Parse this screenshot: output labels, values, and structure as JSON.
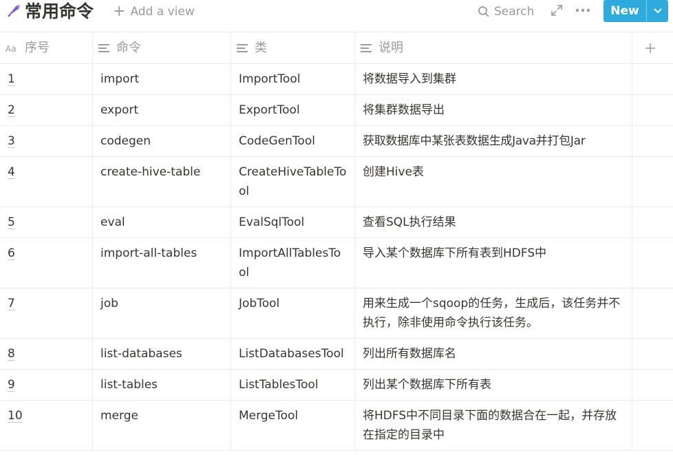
{
  "header": {
    "title": "常用命令",
    "add_view_label": "Add a view",
    "search_label": "Search",
    "new_button_label": "New",
    "accent_color": "#2eaadc"
  },
  "table": {
    "columns": [
      {
        "label": "序号",
        "icon": "title-property-icon"
      },
      {
        "label": "命令",
        "icon": "text-property-icon"
      },
      {
        "label": "类",
        "icon": "text-property-icon"
      },
      {
        "label": "说明",
        "icon": "text-property-icon"
      }
    ],
    "add_column_icon": "plus-icon",
    "rows": [
      {
        "num": "1",
        "cmd": "import",
        "cls": "ImportTool",
        "desc": "将数据导入到集群"
      },
      {
        "num": "2",
        "cmd": "export",
        "cls": "ExportTool",
        "desc": "将集群数据导出"
      },
      {
        "num": "3",
        "cmd": "codegen",
        "cls": "CodeGenTool",
        "desc": "获取数据库中某张表数据生成Java并打包Jar"
      },
      {
        "num": "4",
        "cmd": "create-hive-table",
        "cls": "CreateHiveTableTool",
        "desc": "创建Hive表"
      },
      {
        "num": "5",
        "cmd": "eval",
        "cls": "EvalSqlTool",
        "desc": "查看SQL执行结果"
      },
      {
        "num": "6",
        "cmd": "import-all-tables",
        "cls": "ImportAllTablesTool",
        "desc": "导入某个数据库下所有表到HDFS中"
      },
      {
        "num": "7",
        "cmd": "job",
        "cls": "JobTool",
        "desc": "用来生成一个sqoop的任务，生成后，该任务并不执行，除非使用命令执行该任务。"
      },
      {
        "num": "8",
        "cmd": "list-databases",
        "cls": "ListDatabasesTool",
        "desc": "列出所有数据库名"
      },
      {
        "num": "9",
        "cmd": "list-tables",
        "cls": "ListTablesTool",
        "desc": "列出某个数据库下所有表"
      },
      {
        "num": "10",
        "cmd": "merge",
        "cls": "MergeTool",
        "desc": "将HDFS中不同目录下面的数据合在一起，并存放在指定的目录中"
      }
    ]
  }
}
